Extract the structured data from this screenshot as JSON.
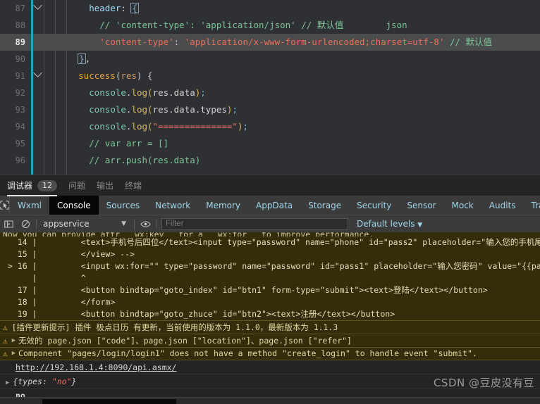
{
  "editor": {
    "lines": [
      {
        "num": "87",
        "fold": true,
        "active": false,
        "tokens": [
          {
            "t": "        ",
            "c": "tok-white"
          },
          {
            "t": "header",
            "c": "tok-key"
          },
          {
            "t": ": ",
            "c": "tok-punct"
          },
          {
            "t": "{",
            "c": "tok-brace brace-box"
          }
        ]
      },
      {
        "num": "88",
        "fold": false,
        "active": false,
        "tokens": [
          {
            "t": "          // 'content-type': 'application/json' // 默认值        json",
            "c": "tok-cm2"
          }
        ]
      },
      {
        "num": "89",
        "fold": false,
        "active": true,
        "tokens": [
          {
            "t": "          ",
            "c": "tok-white"
          },
          {
            "t": "'content-type'",
            "c": "tok-str"
          },
          {
            "t": ": ",
            "c": "tok-punct"
          },
          {
            "t": "'application/x-www-form-urlencoded;charset=utf-8'",
            "c": "tok-str"
          },
          {
            "t": " ",
            "c": "tok-white"
          },
          {
            "t": "// 默认值",
            "c": "tok-cm2"
          }
        ]
      },
      {
        "num": "90",
        "fold": false,
        "active": false,
        "tokens": [
          {
            "t": "      ",
            "c": "tok-white"
          },
          {
            "t": "}",
            "c": "tok-brace brace-box"
          },
          {
            "t": ",",
            "c": "tok-punct"
          }
        ]
      },
      {
        "num": "91",
        "fold": true,
        "active": false,
        "tokens": [
          {
            "t": "      ",
            "c": "tok-white"
          },
          {
            "t": "success",
            "c": "tok-fn"
          },
          {
            "t": "(",
            "c": "tok-punct"
          },
          {
            "t": "res",
            "c": "tok-orange"
          },
          {
            "t": ") {",
            "c": "tok-punct"
          }
        ]
      },
      {
        "num": "92",
        "fold": false,
        "active": false,
        "tokens": [
          {
            "t": "        ",
            "c": "tok-white"
          },
          {
            "t": "console",
            "c": "tok-teal"
          },
          {
            "t": ".",
            "c": "tok-punct"
          },
          {
            "t": "log",
            "c": "tok-fn2"
          },
          {
            "t": "(",
            "c": "tok-fn2"
          },
          {
            "t": "res.data",
            "c": "tok-white"
          },
          {
            "t": ")",
            "c": "tok-fn2"
          },
          {
            "t": ";",
            "c": "tok-brace"
          }
        ]
      },
      {
        "num": "93",
        "fold": false,
        "active": false,
        "tokens": [
          {
            "t": "        ",
            "c": "tok-white"
          },
          {
            "t": "console",
            "c": "tok-teal"
          },
          {
            "t": ".",
            "c": "tok-punct"
          },
          {
            "t": "log",
            "c": "tok-fn2"
          },
          {
            "t": "(",
            "c": "tok-fn2"
          },
          {
            "t": "res.data.types",
            "c": "tok-white"
          },
          {
            "t": ")",
            "c": "tok-fn2"
          },
          {
            "t": ";",
            "c": "tok-brace"
          }
        ]
      },
      {
        "num": "94",
        "fold": false,
        "active": false,
        "tokens": [
          {
            "t": "        ",
            "c": "tok-white"
          },
          {
            "t": "console",
            "c": "tok-teal"
          },
          {
            "t": ".",
            "c": "tok-punct"
          },
          {
            "t": "log",
            "c": "tok-fn2"
          },
          {
            "t": "(",
            "c": "tok-fn2"
          },
          {
            "t": "\"==============\"",
            "c": "tok-str"
          },
          {
            "t": ")",
            "c": "tok-fn2"
          },
          {
            "t": ";",
            "c": "tok-brace"
          }
        ]
      },
      {
        "num": "95",
        "fold": false,
        "active": false,
        "tokens": [
          {
            "t": "        // var arr = []",
            "c": "tok-cm2"
          }
        ]
      },
      {
        "num": "96",
        "fold": false,
        "active": false,
        "tokens": [
          {
            "t": "        // arr.push(res.data)",
            "c": "tok-cm2"
          }
        ]
      }
    ]
  },
  "panel_tabs": {
    "items": [
      {
        "label": "调试器",
        "badge": "12",
        "active": true
      },
      {
        "label": "问题",
        "badge": "",
        "active": false
      },
      {
        "label": "输出",
        "badge": "",
        "active": false
      },
      {
        "label": "终端",
        "badge": "",
        "active": false
      }
    ]
  },
  "devtools_tabs": {
    "picker_icon": "inspect-cursor-icon",
    "items": [
      {
        "label": "Wxml",
        "active": false
      },
      {
        "label": "Console",
        "active": true
      },
      {
        "label": "Sources",
        "active": false
      },
      {
        "label": "Network",
        "active": false
      },
      {
        "label": "Memory",
        "active": false
      },
      {
        "label": "AppData",
        "active": false
      },
      {
        "label": "Storage",
        "active": false
      },
      {
        "label": "Security",
        "active": false
      },
      {
        "label": "Sensor",
        "active": false
      },
      {
        "label": "Mock",
        "active": false
      },
      {
        "label": "Audits",
        "active": false
      },
      {
        "label": "Trace",
        "active": false
      }
    ]
  },
  "console_toolbar": {
    "sidebar_toggle_icon": "panel-toggle-icon",
    "clear_icon": "clear-console-icon",
    "context_value": "appservice",
    "context_caret_icon": "chevron-down-icon",
    "eye_icon": "eye-icon",
    "filter_placeholder": "Filter",
    "filter_value": "",
    "levels_label": "Default levels",
    "levels_caret_icon": "chevron-down-icon"
  },
  "console_output": {
    "clipped_top_line": "Now you can provide attr  `wx:key`  for a  `wx:for`  to improve performance.",
    "code_lines": [
      {
        "marker": "",
        "num": "14",
        "text": "<text>手机号后四位</text><input type=\"password\" name=\"phone\" id=\"pass2\" placeholder=\"输入您的手机尾号\" v"
      },
      {
        "marker": "",
        "num": "15",
        "text": "</view> -->"
      },
      {
        "marker": ">",
        "num": "16",
        "text": "<input wx:for=\"\" type=\"password\" name=\"password\" id=\"pass1\" placeholder=\"输入您密码\" value=\"{{password"
      },
      {
        "marker": "",
        "num": "",
        "text": "^"
      },
      {
        "marker": "",
        "num": "17",
        "text": "<button bindtap=\"goto_index\" id=\"btn1\" form-type=\"submit\"><text>登陆</text></button>"
      },
      {
        "marker": "",
        "num": "18",
        "text": "</form>"
      },
      {
        "marker": "",
        "num": "19",
        "text": "<button bindtap=\"goto_zhuce\" id=\"btn2\"><text>注册</text></button>"
      }
    ],
    "warnings": [
      {
        "icon": "warning-triangle-icon",
        "expandable": false,
        "text": "[插件更新提示] 插件  极点日历  有更新，当前使用的版本为 1.1.0，最新版本为 1.1.3"
      },
      {
        "icon": "warning-triangle-icon",
        "expandable": true,
        "text": "无效的 page.json [\"code\"]、page.json [\"location\"]、page.json [\"refer\"]"
      },
      {
        "icon": "warning-triangle-icon",
        "expandable": true,
        "text": "Component \"pages/login/login1\" does not have a method \"create_login\" to handle event \"submit\"."
      }
    ],
    "logs": [
      {
        "type": "link",
        "text": "http://192.168.1.4:8090/api.asmx/"
      },
      {
        "type": "object",
        "expandable": true,
        "prefix": "{types: ",
        "value": "\"no\"",
        "suffix": "}"
      },
      {
        "type": "text",
        "text": "no"
      }
    ]
  },
  "watermark": {
    "text": "CSDN @豆皮没有豆"
  },
  "colors": {
    "editor_bg": "#2e3033",
    "active_line": "#4a4c4d",
    "blue_bar": "#22a0c8",
    "warn_bg": "#332d0c",
    "warn_icon": "#f0c030",
    "tab_link": "#9fd5e8",
    "string": "#e8705a",
    "comment": "#7ec699"
  }
}
